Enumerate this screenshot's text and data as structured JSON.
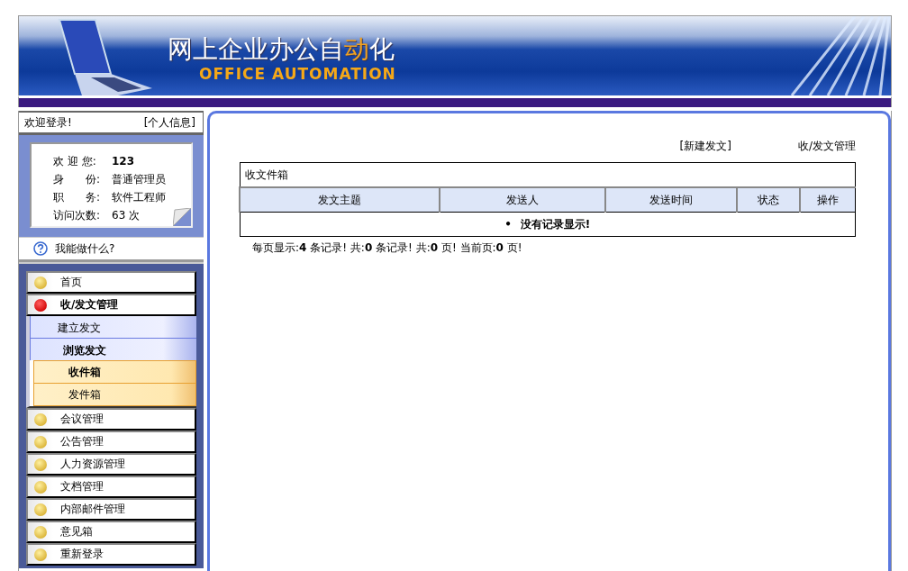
{
  "banner": {
    "title_before": "网上企业办公自",
    "title_accent": "动",
    "title_after": "化",
    "subtitle": "OFFICE AUTOMATION"
  },
  "sidebar": {
    "welcome": "欢迎登录!",
    "profile_link": "[个人信息]",
    "user_info": [
      {
        "label": "欢 迎 您:",
        "value": "123",
        "bold": true
      },
      {
        "label": "身　　份:",
        "value": "普通管理员",
        "bold": false
      },
      {
        "label": "职　　务:",
        "value": "软件工程师",
        "bold": false
      },
      {
        "label": "访问次数:",
        "value": "63 次",
        "bold": false
      }
    ],
    "help": "我能做什么?",
    "nav": [
      {
        "label": "首页",
        "selected": false
      },
      {
        "label": "收/发文管理",
        "selected": true,
        "children": [
          {
            "label": "建立发文",
            "selected": false
          },
          {
            "label": "浏览发文",
            "selected": false,
            "children": [
              {
                "label": "收件箱",
                "selected": true
              },
              {
                "label": "发件箱",
                "selected": false
              }
            ]
          }
        ]
      },
      {
        "label": "会议管理",
        "selected": false
      },
      {
        "label": "公告管理",
        "selected": false
      },
      {
        "label": "人力资源管理",
        "selected": false
      },
      {
        "label": "文档管理",
        "selected": false
      },
      {
        "label": "内部邮件管理",
        "selected": false
      },
      {
        "label": "意见箱",
        "selected": false
      },
      {
        "label": "重新登录",
        "selected": false
      }
    ]
  },
  "main": {
    "new_link": "[新建发文]",
    "breadcrumb": "收/发文管理",
    "table": {
      "caption": "收文件箱",
      "columns": [
        "发文主题",
        "发送人",
        "发送时间",
        "状态",
        "操作"
      ],
      "bullet": "•",
      "empty": "没有记录显示!"
    },
    "pagination": "每页显示:**4** 条记录! 共:**0** 条记录! 共:**0** 页! 当前页:**0** 页!"
  }
}
